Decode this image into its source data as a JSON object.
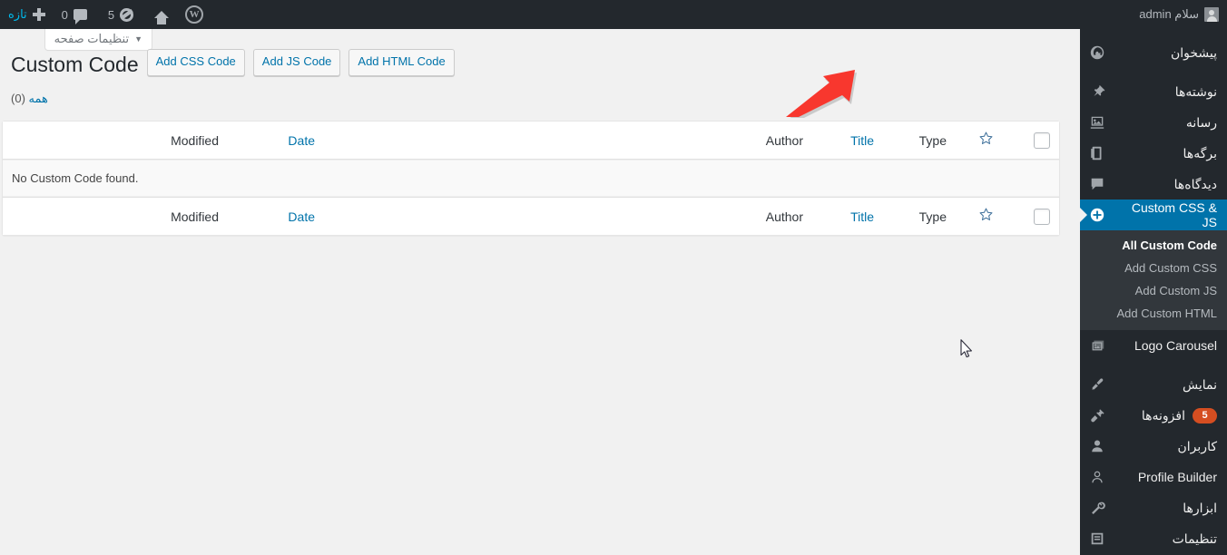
{
  "adminbar": {
    "greeting": "سلام admin",
    "new_label": "تازه",
    "comments_count": "0",
    "updates_count": "5",
    "icons": {
      "avatar": "avatar-icon",
      "plus": "plus-icon",
      "comment": "comment-bubble-icon",
      "updates": "updates-icon",
      "home": "home-icon",
      "wordpress": "wordpress-logo-icon"
    }
  },
  "screen_meta": {
    "screen_options_label": "تنظیمات صفحه",
    "caret": "▼"
  },
  "sidebar": {
    "items": [
      {
        "label": "پیشخوان",
        "icon": "dashboard-icon",
        "current": false
      },
      {
        "label": "نوشته‌ها",
        "icon": "posts-pin-icon",
        "current": false
      },
      {
        "label": "رسانه",
        "icon": "media-icon",
        "current": false
      },
      {
        "label": "برگه‌ها",
        "icon": "pages-icon",
        "current": false
      },
      {
        "label": "دیدگاه‌ها",
        "icon": "comments-icon",
        "current": false
      },
      {
        "label": "Custom CSS & JS",
        "icon": "plus-circle-icon",
        "current": true
      },
      {
        "label": "Logo Carousel",
        "icon": "images-icon",
        "current": false
      },
      {
        "label": "نمایش",
        "icon": "appearance-brush-icon",
        "current": false
      },
      {
        "label": "افزونه‌ها",
        "icon": "plugins-plug-icon",
        "current": false,
        "badge": "5"
      },
      {
        "label": "کاربران",
        "icon": "users-icon",
        "current": false
      },
      {
        "label": "Profile Builder",
        "icon": "profile-icon",
        "current": false
      },
      {
        "label": "ابزارها",
        "icon": "tools-wrench-icon",
        "current": false
      },
      {
        "label": "تنظیمات",
        "icon": "settings-icon",
        "current": false
      }
    ],
    "submenu": [
      {
        "label": "All Custom Code",
        "current": true
      },
      {
        "label": "Add Custom CSS",
        "current": false
      },
      {
        "label": "Add Custom JS",
        "current": false
      },
      {
        "label": "Add Custom HTML",
        "current": false
      }
    ]
  },
  "page": {
    "title": "Custom Code",
    "actions": [
      {
        "label": "Add CSS Code"
      },
      {
        "label": "Add JS Code"
      },
      {
        "label": "Add HTML Code"
      }
    ],
    "filters": {
      "all_label": "همه",
      "all_count": "(0)"
    }
  },
  "table": {
    "columns": {
      "checkbox": "select-all",
      "star": "☆",
      "type": "Type",
      "title": "Title",
      "author": "Author",
      "date": "Date",
      "modified": "Modified"
    },
    "empty_message": ".No Custom Code found"
  },
  "annotation": {
    "arrow_color": "#f8372e"
  },
  "colors": {
    "admin_bar": "#23282d",
    "menu_bg": "#23282d",
    "submenu_bg": "#32373c",
    "accent_blue": "#0073aa",
    "content_bg": "#f1f1f1",
    "badge_orange": "#d54e21"
  }
}
